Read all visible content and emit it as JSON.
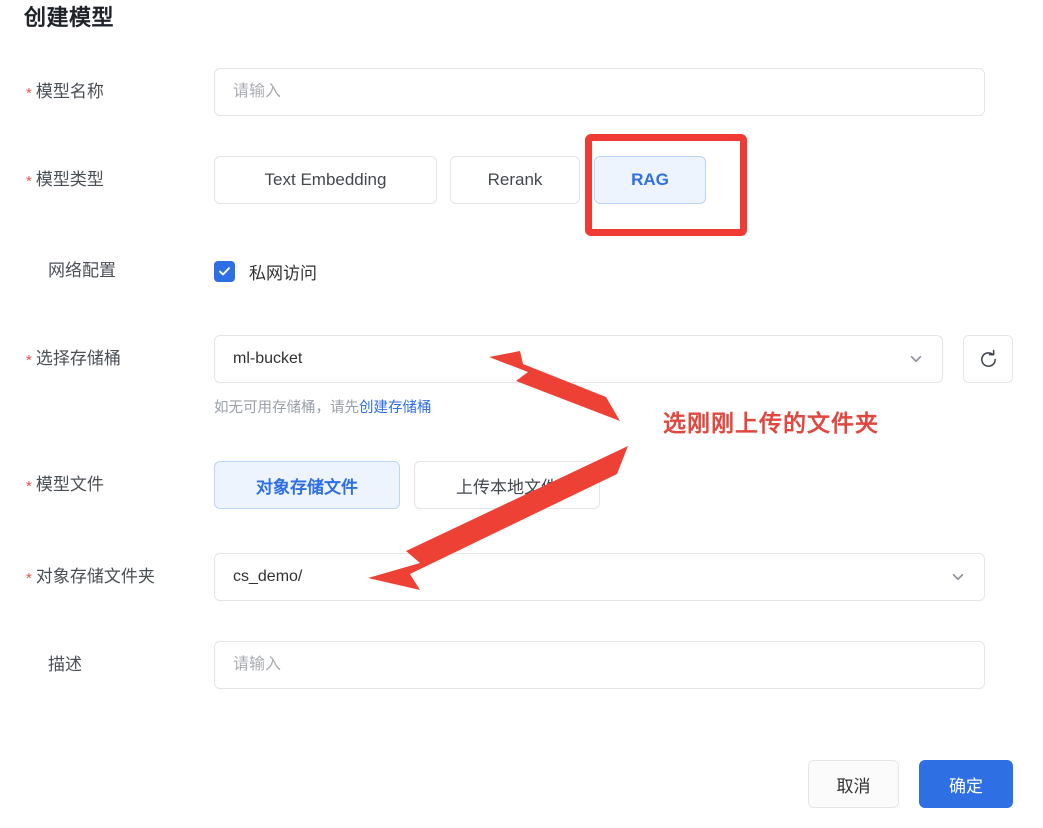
{
  "page": {
    "title": "创建模型"
  },
  "form": {
    "model_name": {
      "label": "模型名称",
      "required_mark": "*",
      "placeholder": "请输入",
      "value": ""
    },
    "model_type": {
      "label": "模型类型",
      "required_mark": "*",
      "options": [
        {
          "label": "Text Embedding",
          "selected": false
        },
        {
          "label": "Rerank",
          "selected": false
        },
        {
          "label": "RAG",
          "selected": true
        }
      ]
    },
    "network_config": {
      "label": "网络配置",
      "checkbox_label": "私网访问",
      "checked": true
    },
    "bucket": {
      "label": "选择存储桶",
      "required_mark": "*",
      "value": "ml-bucket",
      "helper_prefix": "如无可用存储桶，请先",
      "helper_link": "创建存储桶",
      "refresh_icon": "refresh-icon",
      "chevron_icon": "chevron-down-icon"
    },
    "model_file": {
      "label": "模型文件",
      "required_mark": "*",
      "options": [
        {
          "label": "对象存储文件",
          "selected": true
        },
        {
          "label": "上传本地文件",
          "selected": false
        }
      ]
    },
    "object_folder": {
      "label": "对象存储文件夹",
      "required_mark": "*",
      "value": "cs_demo/",
      "chevron_icon": "chevron-down-icon"
    },
    "description": {
      "label": "描述",
      "placeholder": "请输入",
      "value": ""
    }
  },
  "footer": {
    "cancel_label": "取消",
    "confirm_label": "确定"
  },
  "annotations": {
    "highlight_color": "#ef3b33",
    "note_color": "#e0483f",
    "note_text": "选刚刚上传的文件夹",
    "arrow_color": "#ee4136"
  }
}
